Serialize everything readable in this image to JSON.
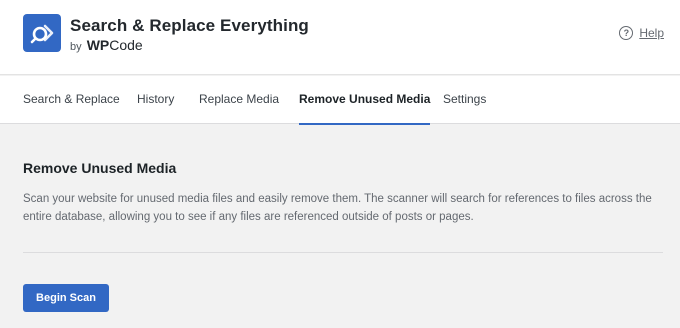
{
  "header": {
    "app_title": "Search & Replace Everything",
    "byline_prefix": "by",
    "brand_wp": "WP",
    "brand_code": "Code",
    "help_label": "Help",
    "help_icon_glyph": "?"
  },
  "tabs": [
    {
      "label": "Search & Replace"
    },
    {
      "label": "History"
    },
    {
      "label": "Replace Media"
    },
    {
      "label": "Remove Unused Media",
      "active": true
    },
    {
      "label": "Settings"
    }
  ],
  "main": {
    "section_title": "Remove Unused Media",
    "description": "Scan your website for unused media files and easily remove them. The scanner will search for references to files across the entire database, allowing you to see if any files are referenced outside of posts or pages.",
    "scan_button_label": "Begin Scan"
  },
  "colors": {
    "accent": "#3268c4",
    "page_background": "#f2f2f2",
    "header_background": "#ffffff"
  },
  "icons": {
    "logo": "search-replace-logo-icon",
    "help": "help-circle-icon"
  }
}
